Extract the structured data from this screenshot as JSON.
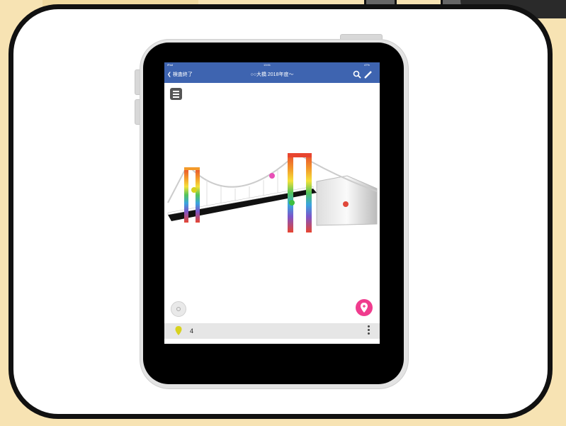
{
  "status_bar": {
    "device": "iPad",
    "time": "13:51",
    "battery": "47%"
  },
  "nav": {
    "back_label": "検査終了",
    "title": "○○大橋 2018年度〜"
  },
  "icons": {
    "back": "chevron-left-icon",
    "search": "search-icon",
    "edit": "pencil-icon",
    "menu": "hamburger-menu-icon",
    "locate": "locate-icon",
    "add_pin": "add-pin-icon",
    "pin": "map-pin-icon",
    "more": "more-vertical-icon"
  },
  "bottom_bar": {
    "pin_count": "4"
  },
  "colors": {
    "nav": "#3e64b0",
    "add_pin": "#f03c8e",
    "pin_yellow": "#d8d21e",
    "pin_magenta": "#e84fb7",
    "pin_green": "#3fbf3f",
    "pin_red": "#e0483a"
  }
}
